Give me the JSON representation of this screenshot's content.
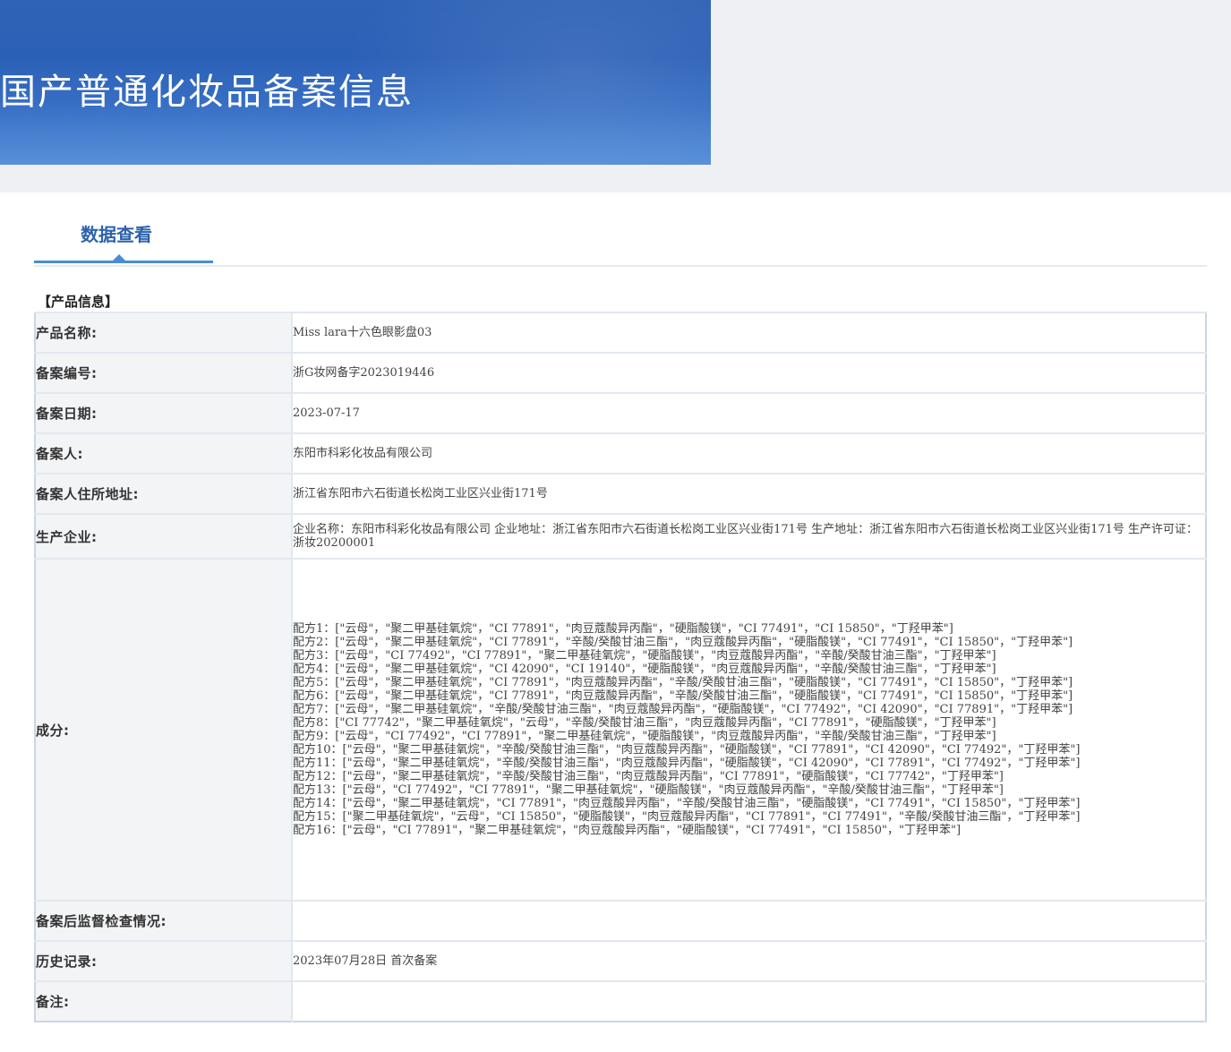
{
  "banner": {
    "title": "国产普通化妆品备案信息"
  },
  "tab": {
    "label": "数据查看"
  },
  "section": {
    "title": "【产品信息】"
  },
  "rows": {
    "product_name": {
      "label": "产品名称:",
      "value": "Miss lara十六色眼影盘03"
    },
    "record_no": {
      "label": "备案编号:",
      "value": "浙G妆网备字2023019446"
    },
    "record_date": {
      "label": "备案日期:",
      "value": "2023-07-17"
    },
    "registrant": {
      "label": "备案人:",
      "value": "东阳市科彩化妆品有限公司"
    },
    "registrant_address": {
      "label": "备案人住所地址:",
      "value": "浙江省东阳市六石街道长松岗工业区兴业街171号"
    },
    "manufacturer": {
      "label": "生产企业:",
      "value": "企业名称：东阳市科彩化妆品有限公司 企业地址：浙江省东阳市六石街道长松岗工业区兴业街171号 生产地址：浙江省东阳市六石街道长松岗工业区兴业街171号 生产许可证：浙妆20200001"
    },
    "ingredients": {
      "label": "成分:",
      "formulas": [
        "配方1：[\"云母\"，\"聚二甲基硅氧烷\"，\"CI 77891\"，\"肉豆蔻酸异丙酯\"，\"硬脂酸镁\"，\"CI 77491\"，\"CI 15850\"，\"丁羟甲苯\"]",
        "配方2：[\"云母\"，\"聚二甲基硅氧烷\"，\"CI 77891\"，\"辛酸/癸酸甘油三酯\"，\"肉豆蔻酸异丙酯\"，\"硬脂酸镁\"，\"CI 77491\"，\"CI 15850\"，\"丁羟甲苯\"]",
        "配方3：[\"云母\"，\"CI 77492\"，\"CI 77891\"，\"聚二甲基硅氧烷\"，\"硬脂酸镁\"，\"肉豆蔻酸异丙酯\"，\"辛酸/癸酸甘油三酯\"，\"丁羟甲苯\"]",
        "配方4：[\"云母\"，\"聚二甲基硅氧烷\"，\"CI 42090\"，\"CI 19140\"，\"硬脂酸镁\"，\"肉豆蔻酸异丙酯\"，\"辛酸/癸酸甘油三酯\"，\"丁羟甲苯\"]",
        "配方5：[\"云母\"，\"聚二甲基硅氧烷\"，\"CI 77891\"，\"肉豆蔻酸异丙酯\"，\"辛酸/癸酸甘油三酯\"，\"硬脂酸镁\"，\"CI 77491\"，\"CI 15850\"，\"丁羟甲苯\"]",
        "配方6：[\"云母\"，\"聚二甲基硅氧烷\"，\"CI 77891\"，\"肉豆蔻酸异丙酯\"，\"辛酸/癸酸甘油三酯\"，\"硬脂酸镁\"，\"CI 77491\"，\"CI 15850\"，\"丁羟甲苯\"]",
        "配方7：[\"云母\"，\"聚二甲基硅氧烷\"，\"辛酸/癸酸甘油三酯\"，\"肉豆蔻酸异丙酯\"，\"硬脂酸镁\"，\"CI 77492\"，\"CI 42090\"，\"CI 77891\"，\"丁羟甲苯\"]",
        "配方8：[\"CI 77742\"，\"聚二甲基硅氧烷\"，\"云母\"，\"辛酸/癸酸甘油三酯\"，\"肉豆蔻酸异丙酯\"，\"CI 77891\"，\"硬脂酸镁\"，\"丁羟甲苯\"]",
        "配方9：[\"云母\"，\"CI 77492\"，\"CI 77891\"，\"聚二甲基硅氧烷\"，\"硬脂酸镁\"，\"肉豆蔻酸异丙酯\"，\"辛酸/癸酸甘油三酯\"，\"丁羟甲苯\"]",
        "配方10：[\"云母\"，\"聚二甲基硅氧烷\"，\"辛酸/癸酸甘油三酯\"，\"肉豆蔻酸异丙酯\"，\"硬脂酸镁\"，\"CI 77891\"，\"CI 42090\"，\"CI 77492\"，\"丁羟甲苯\"]",
        "配方11：[\"云母\"，\"聚二甲基硅氧烷\"，\"辛酸/癸酸甘油三酯\"，\"肉豆蔻酸异丙酯\"，\"硬脂酸镁\"，\"CI 42090\"，\"CI 77891\"，\"CI 77492\"，\"丁羟甲苯\"]",
        "配方12：[\"云母\"，\"聚二甲基硅氧烷\"，\"辛酸/癸酸甘油三酯\"，\"肉豆蔻酸异丙酯\"，\"CI 77891\"，\"硬脂酸镁\"，\"CI 77742\"，\"丁羟甲苯\"]",
        "配方13：[\"云母\"，\"CI 77492\"，\"CI 77891\"，\"聚二甲基硅氧烷\"，\"硬脂酸镁\"，\"肉豆蔻酸异丙酯\"，\"辛酸/癸酸甘油三酯\"，\"丁羟甲苯\"]",
        "配方14：[\"云母\"，\"聚二甲基硅氧烷\"，\"CI 77891\"，\"肉豆蔻酸异丙酯\"，\"辛酸/癸酸甘油三酯\"，\"硬脂酸镁\"，\"CI 77491\"，\"CI 15850\"，\"丁羟甲苯\"]",
        "配方15：[\"聚二甲基硅氧烷\"，\"云母\"，\"CI 15850\"，\"硬脂酸镁\"，\"肉豆蔻酸异丙酯\"，\"CI 77891\"，\"CI 77491\"，\"辛酸/癸酸甘油三酯\"，\"丁羟甲苯\"]",
        "配方16：[\"云母\"，\"CI 77891\"，\"聚二甲基硅氧烷\"，\"肉豆蔻酸异丙酯\"，\"硬脂酸镁\"，\"CI 77491\"，\"CI 15850\"，\"丁羟甲苯\"]"
      ]
    },
    "post_check": {
      "label": "备案后监督检查情况:",
      "value": ""
    },
    "history": {
      "label": "历史记录:",
      "value": "2023年07月28日 首次备案"
    },
    "remarks": {
      "label": "备注:",
      "value": ""
    }
  },
  "colors": {
    "banner_blue": "#2b60b7",
    "tab_accent": "#4a8cd6",
    "tab_text": "#2c62ad",
    "label_bg": "#f3f4f6",
    "table_border": "#c9d6e6"
  }
}
